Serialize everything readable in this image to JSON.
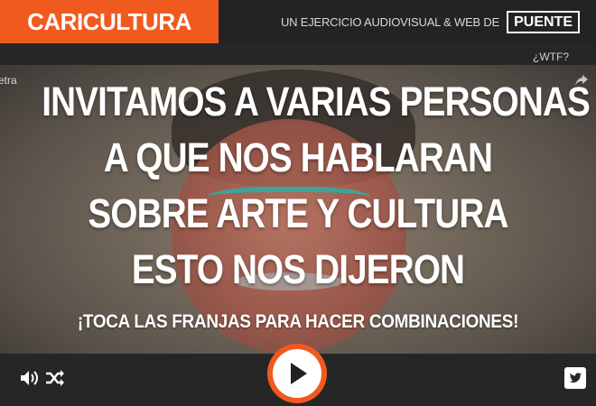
{
  "header": {
    "brand": "CARICULTURA",
    "credit_text": "UN EJERCICIO AUDIOVISUAL & WEB DE",
    "partner_logo": "PUENTE"
  },
  "wtf_link": "¿WTF?",
  "video": {
    "caption_fragment": "retra"
  },
  "headline": {
    "lines": [
      "INVITAMOS A VARIAS PERSONAS",
      "A QUE NOS HABLARAN",
      "SOBRE ARTE Y CULTURA",
      "ESTO NOS DIJERON"
    ]
  },
  "instruction": "¡TOCA LAS FRANJAS PARA HACER COMBINACIONES!",
  "controls": {
    "icons": [
      "volume-icon",
      "shuffle-icon",
      "play-icon",
      "twitter-icon"
    ]
  },
  "colors": {
    "accent": "#f15a1f",
    "bar": "#262626"
  }
}
